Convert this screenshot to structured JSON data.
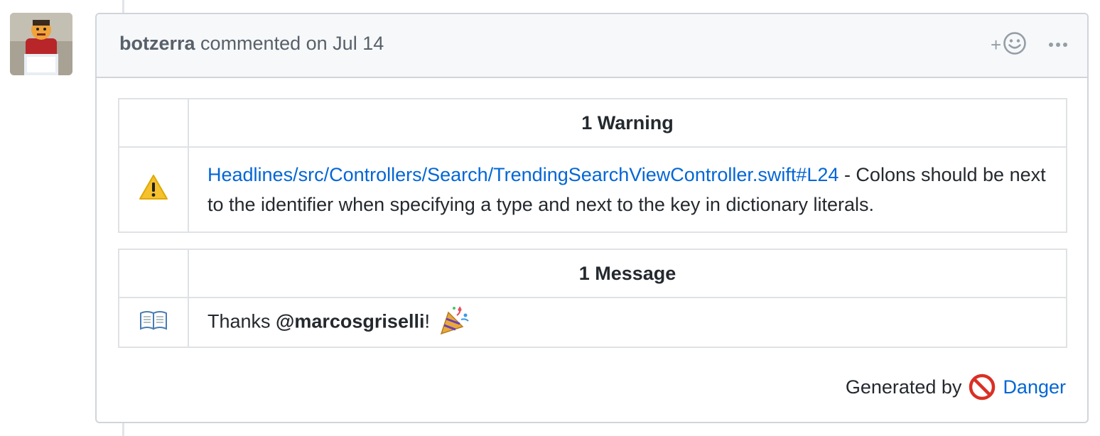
{
  "comment": {
    "author": "botzerra",
    "action": "commented on",
    "date": "Jul 14",
    "reaction_plus": "+"
  },
  "warnings": {
    "header": "1 Warning",
    "items": [
      {
        "icon": "warning-icon",
        "link": "Headlines/src/Controllers/Search/TrendingSearchViewController.swift#L24",
        "text": " - Colons should be next to the identifier when specifying a type and next to the key in dictionary literals."
      }
    ]
  },
  "messages": {
    "header": "1 Message",
    "items": [
      {
        "icon": "open-book-icon",
        "prefix": "Thanks ",
        "mention": "@marcosgriselli",
        "suffix": "!",
        "trailing_icon": "party-popper-icon"
      }
    ]
  },
  "footer": {
    "prefix": "Generated by",
    "icon": "no-entry-icon",
    "link": "Danger"
  },
  "colors": {
    "link": "#0366d6",
    "warning": "#f5c12e",
    "no_entry": "#d93025",
    "border": "#d1d5da"
  }
}
